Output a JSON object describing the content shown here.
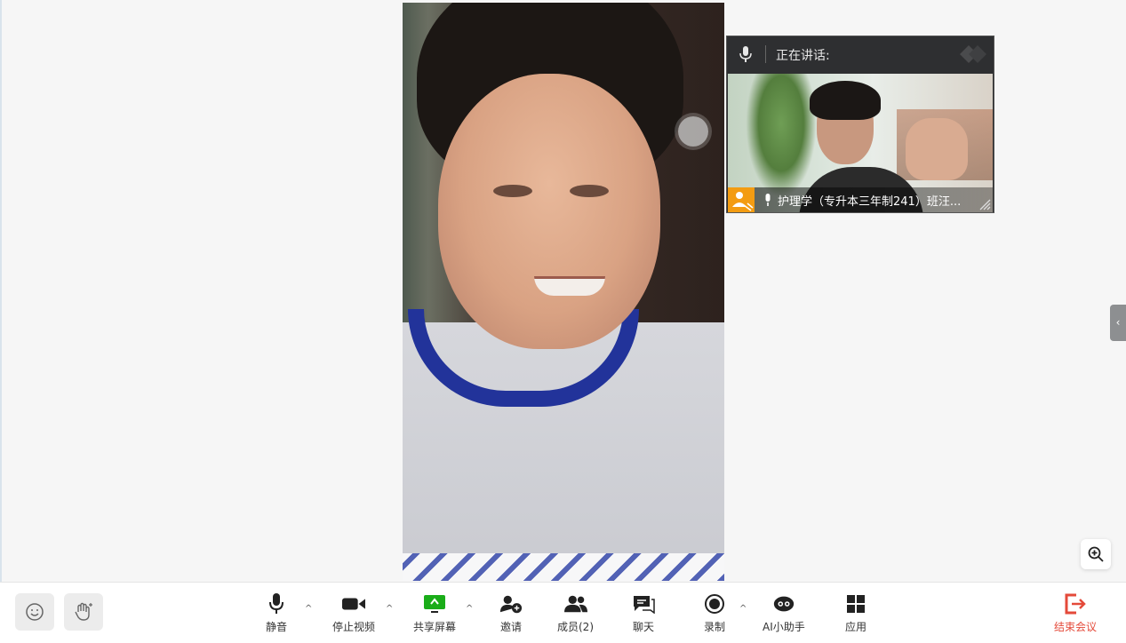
{
  "speaker_panel": {
    "title": "正在讲话:",
    "participant_name": "护理学（专升本三年制241）班汪..."
  },
  "toolbar": {
    "mute_label": "静音",
    "stop_video_label": "停止视频",
    "share_screen_label": "共享屏幕",
    "invite_label": "邀请",
    "members_label": "成员(2)",
    "chat_label": "聊天",
    "record_label": "录制",
    "ai_assistant_label": "AI小助手",
    "apps_label": "应用",
    "end_meeting_label": "结束会议"
  },
  "colors": {
    "accent_green": "#1aad19",
    "end_red": "#e44a3a",
    "badge_orange": "#f39c12"
  }
}
